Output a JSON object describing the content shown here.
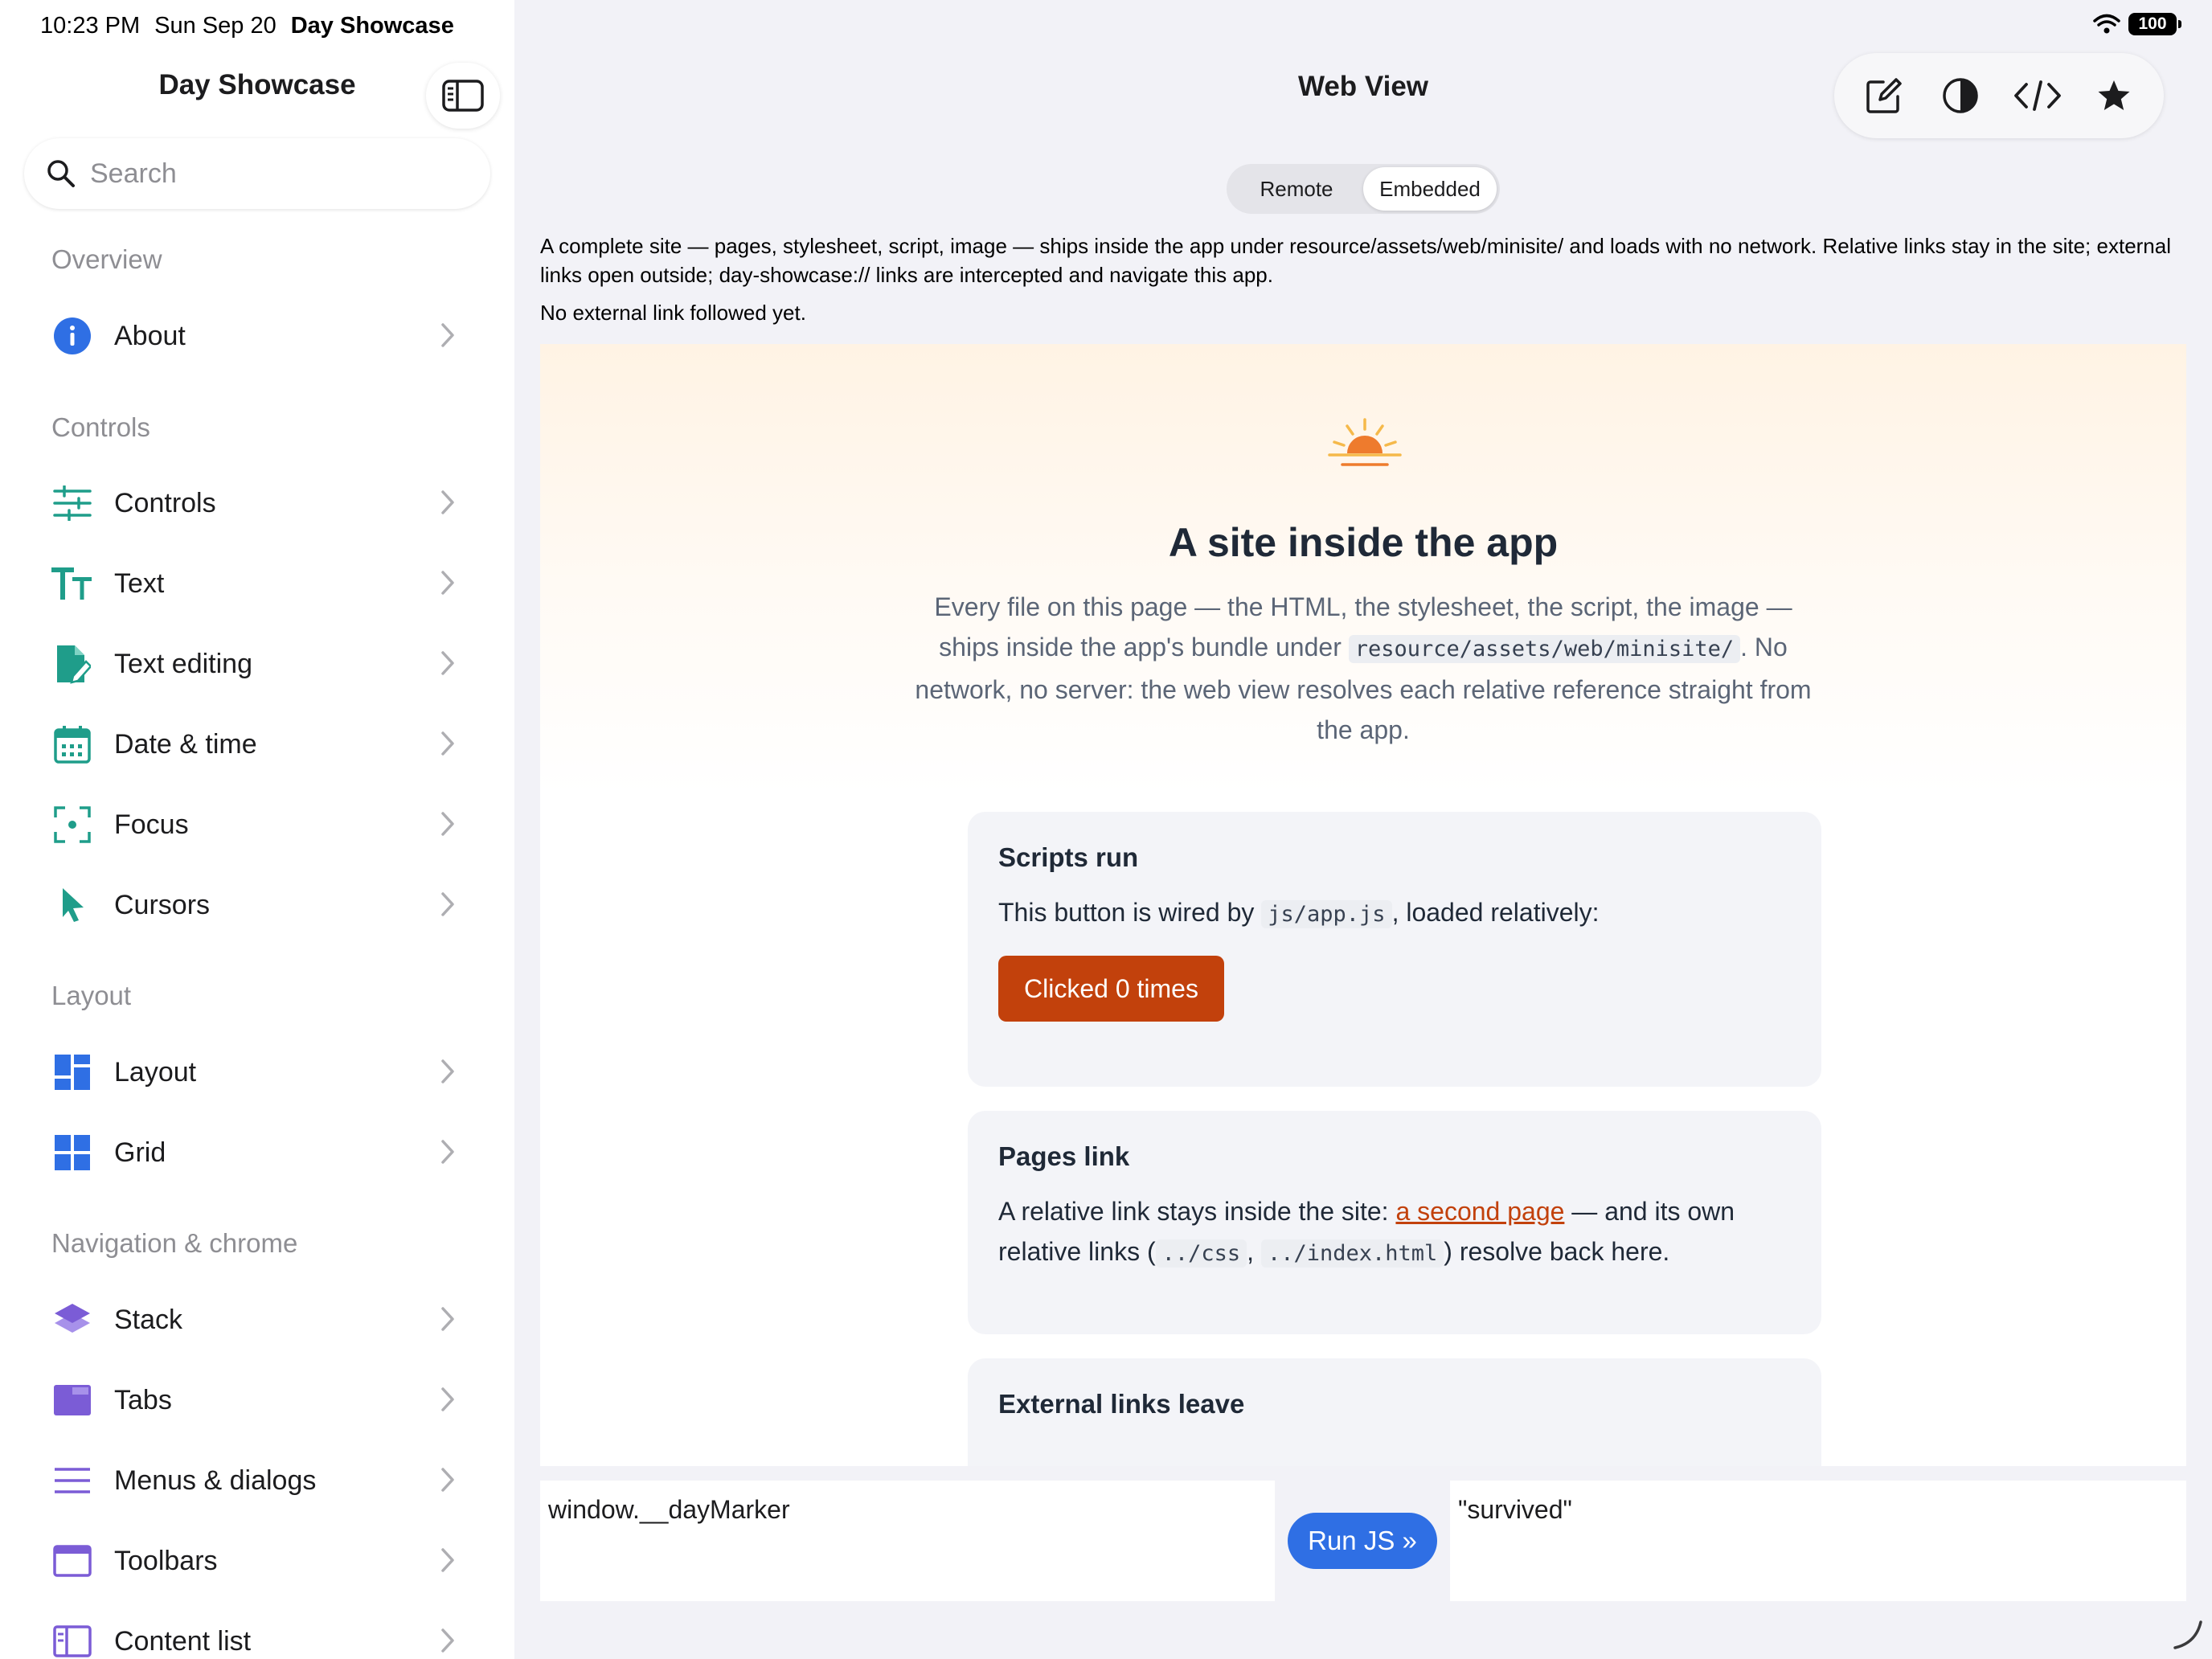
{
  "status_bar": {
    "time": "10:23 PM",
    "date": "Sun Sep 20",
    "app": "Day Showcase",
    "battery": "100"
  },
  "sidebar": {
    "title": "Day Showcase",
    "search_placeholder": "Search",
    "sections": [
      {
        "header": "Overview",
        "items": [
          {
            "label": "About",
            "icon": "info-icon",
            "color": "#2f6fe4"
          }
        ]
      },
      {
        "header": "Controls",
        "items": [
          {
            "label": "Controls",
            "icon": "sliders-icon",
            "color": "#1f9d8a"
          },
          {
            "label": "Text",
            "icon": "text-size-icon",
            "color": "#1f9d8a"
          },
          {
            "label": "Text editing",
            "icon": "doc-edit-icon",
            "color": "#1f9d8a"
          },
          {
            "label": "Date & time",
            "icon": "calendar-icon",
            "color": "#1f9d8a"
          },
          {
            "label": "Focus",
            "icon": "focus-icon",
            "color": "#1f9d8a"
          },
          {
            "label": "Cursors",
            "icon": "cursor-icon",
            "color": "#1f9d8a"
          }
        ]
      },
      {
        "header": "Layout",
        "items": [
          {
            "label": "Layout",
            "icon": "layout-icon",
            "color": "#2f6fe4"
          },
          {
            "label": "Grid",
            "icon": "grid-icon",
            "color": "#2f6fe4"
          }
        ]
      },
      {
        "header": "Navigation & chrome",
        "items": [
          {
            "label": "Stack",
            "icon": "stack-icon",
            "color": "#7b5cd6"
          },
          {
            "label": "Tabs",
            "icon": "tabs-icon",
            "color": "#7b5cd6"
          },
          {
            "label": "Menus & dialogs",
            "icon": "menu-icon",
            "color": "#7b5cd6"
          },
          {
            "label": "Toolbars",
            "icon": "toolbar-icon",
            "color": "#7b5cd6"
          },
          {
            "label": "Content list",
            "icon": "content-list-icon",
            "color": "#7b5cd6"
          }
        ]
      }
    ]
  },
  "main": {
    "title": "Web View",
    "segments": [
      "Remote",
      "Embedded"
    ],
    "selected_segment": "Embedded",
    "description": "A complete site — pages, stylesheet, script, image — ships inside the app under resource/assets/web/minisite/ and loads with no network. Relative links stay in the site; external links open outside; day-showcase:// links are intercepted and navigate this app.",
    "status": "No external link followed yet."
  },
  "webpage": {
    "title": "A site inside the app",
    "lead_1": "Every file on this page — the HTML, the stylesheet, the script, the image — ships inside the app's bundle under ",
    "lead_code": "resource/assets/web/minisite/",
    "lead_2": ". No network, no server: the web view resolves each relative reference straight from the app.",
    "card1": {
      "title": "Scripts run",
      "text_1": "This button is wired by ",
      "code": "js/app.js",
      "text_2": ", loaded relatively:",
      "button": "Clicked 0 times"
    },
    "card2": {
      "title": "Pages link",
      "text_1": "A relative link stays inside the site: ",
      "link": "a second page",
      "text_2": " — and its own relative links (",
      "code_1": "../css",
      "sep": ", ",
      "code_2": "../index.html",
      "text_3": ") resolve back here."
    },
    "card3": {
      "title": "External links leave"
    }
  },
  "js_runner": {
    "input": "window.__dayMarker",
    "button": "Run JS »",
    "output": "\"survived\""
  },
  "colors": {
    "accent": "#2f6fe4",
    "web_accent": "#c2410c"
  }
}
